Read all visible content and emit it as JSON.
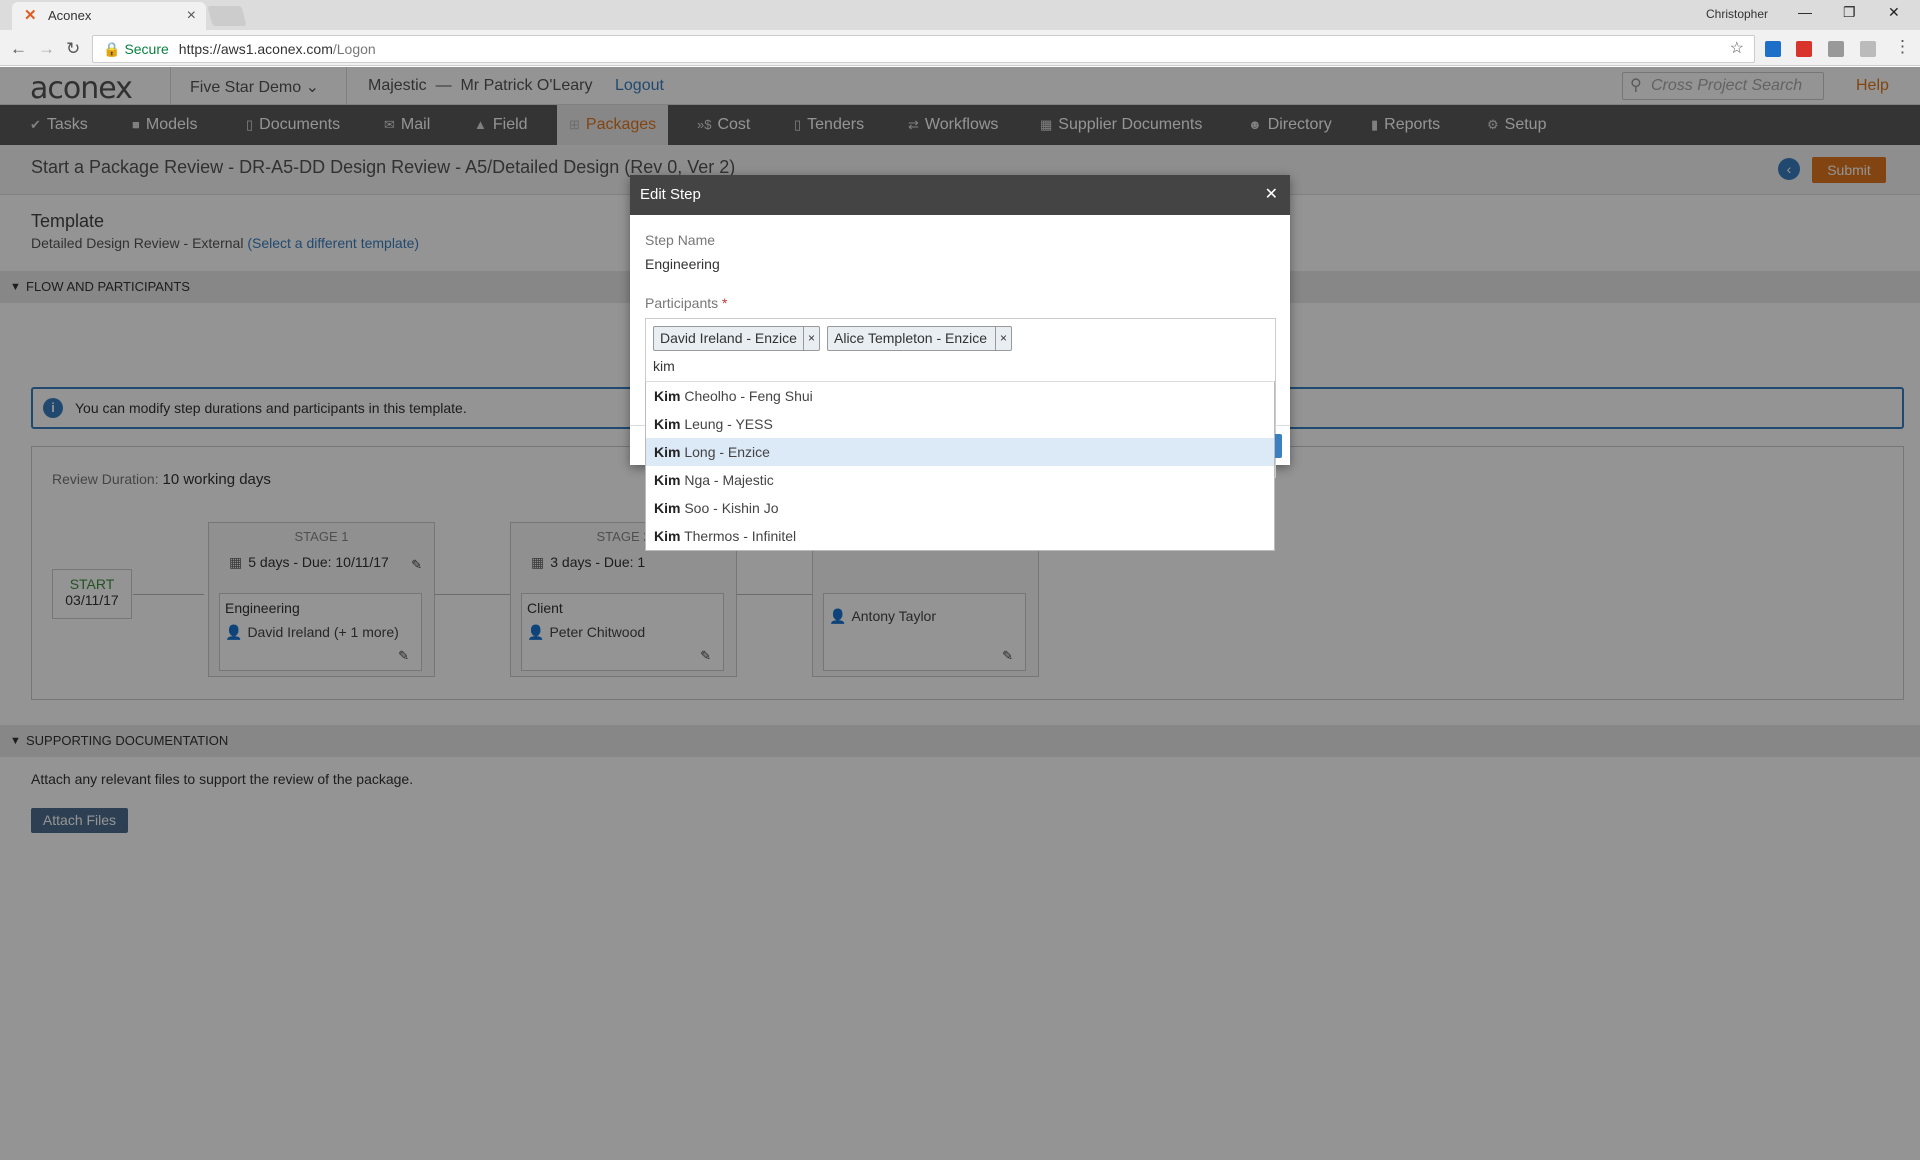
{
  "browser": {
    "tab_title": "Aconex",
    "favicon": "aconex-x-icon",
    "profile_name": "Christopher",
    "secure_label": "Secure",
    "url_host": "https://aws1.aconex.com",
    "url_path": "/Logon"
  },
  "topbar": {
    "logo": "aconex",
    "project": "Five Star Demo",
    "org": "Majestic",
    "dash": "—",
    "user": "Mr Patrick O'Leary",
    "logout": "Logout",
    "search_placeholder": "Cross Project Search",
    "help": "Help"
  },
  "nav": [
    {
      "label": "Tasks",
      "icon": "check-icon"
    },
    {
      "label": "Models",
      "icon": "cube-icon"
    },
    {
      "label": "Documents",
      "icon": "document-icon"
    },
    {
      "label": "Mail",
      "icon": "mail-icon"
    },
    {
      "label": "Field",
      "icon": "warning-icon"
    },
    {
      "label": "Packages",
      "icon": "packages-icon",
      "active": true
    },
    {
      "label": "Cost",
      "icon": "dollar-icon"
    },
    {
      "label": "Tenders",
      "icon": "tender-icon"
    },
    {
      "label": "Workflows",
      "icon": "workflow-icon"
    },
    {
      "label": "Supplier Documents",
      "icon": "supplier-icon"
    },
    {
      "label": "Directory",
      "icon": "people-icon"
    },
    {
      "label": "Reports",
      "icon": "chart-icon"
    },
    {
      "label": "Setup",
      "icon": "gear-icon"
    }
  ],
  "page": {
    "title": "Start a Package Review - DR-A5-DD Design Review - A5/Detailed Design (Rev 0, Ver 2)",
    "submit": "Submit",
    "template_label": "Template",
    "template_name": "Detailed Design Review - External",
    "template_link": "(Select a different template)",
    "flow_section": "FLOW AND PARTICIPANTS",
    "info_text": "You can modify step durations and participants in this template.",
    "review_duration_label": "Review Duration:",
    "review_duration_value": "10 working days",
    "start_label": "START",
    "start_date": "03/11/17",
    "stages": [
      {
        "name": "STAGE 1",
        "days": "5 days - Due:",
        "due": "10/11/17",
        "step": "Engineering",
        "participant": "David Ireland (+ 1 more)"
      },
      {
        "name": "STAGE 2",
        "days": "3 days - Due:",
        "due": "1",
        "step": "Client",
        "participant": "Peter Chitwood"
      },
      {
        "name": "",
        "days": "",
        "due": "",
        "step": "",
        "participant": "Antony Taylor"
      }
    ],
    "supporting_section": "SUPPORTING DOCUMENTATION",
    "attach_text": "Attach any relevant files to support the review of the package.",
    "attach_button": "Attach Files"
  },
  "modal": {
    "title": "Edit Step",
    "step_name_label": "Step Name",
    "step_name": "Engineering",
    "participants_label": "Participants",
    "required_mark": "*",
    "chips": [
      "David Ireland - Enzice",
      "Alice Templeton - Enzice"
    ],
    "typed": "kim",
    "options": [
      {
        "match": "Kim",
        "rest": " Cheolho - Feng Shui"
      },
      {
        "match": "Kim",
        "rest": " Leung - YESS"
      },
      {
        "match": "Kim",
        "rest": " Long - Enzice",
        "highlighted": true
      },
      {
        "match": "Kim",
        "rest": " Nga - Majestic"
      },
      {
        "match": "Kim",
        "rest": " Soo - Kishin Jo"
      },
      {
        "match": "Kim",
        "rest": " Thermos - Infinitel"
      }
    ]
  },
  "colors": {
    "accent": "#e0781f",
    "link": "#3a7fc1",
    "nav_bg": "#5a5a5a"
  }
}
